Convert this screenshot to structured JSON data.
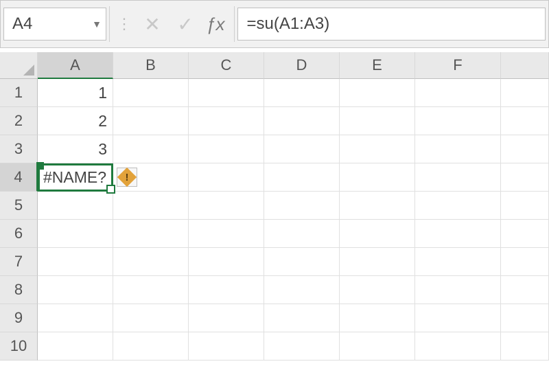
{
  "formula_bar": {
    "name_box": "A4",
    "formula": "=su(A1:A3)"
  },
  "columns": [
    "A",
    "B",
    "C",
    "D",
    "E",
    "F"
  ],
  "row_numbers": [
    1,
    2,
    3,
    4,
    5,
    6,
    7,
    8,
    9,
    10
  ],
  "cells": {
    "A1": "1",
    "A2": "2",
    "A3": "3",
    "A4": "#NAME?"
  },
  "active_cell": {
    "col": "A",
    "row": 4
  },
  "icons": {
    "dropdown": "▼",
    "vdots": "⋮",
    "cancel": "✕",
    "enter": "✓",
    "fx": "ƒx",
    "error_bang": "!"
  }
}
